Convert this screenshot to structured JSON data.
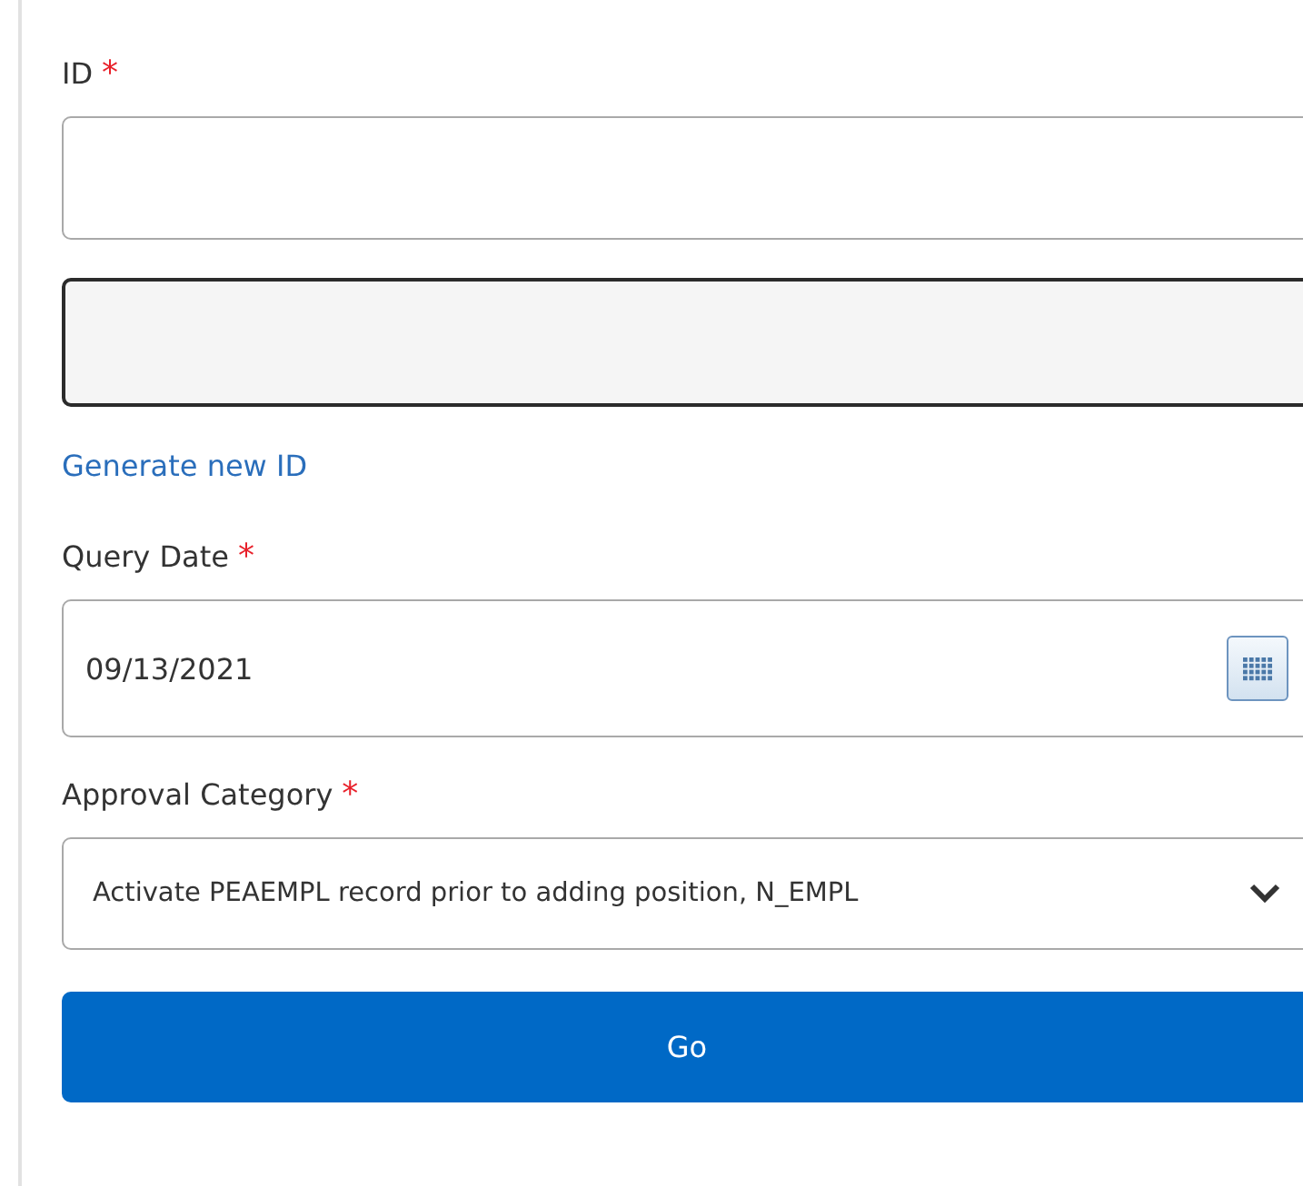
{
  "fields": [
    {
      "kind": "text",
      "label": "ID",
      "required": true,
      "required_mark": "*",
      "disabled": false
    },
    {
      "kind": "text",
      "disabled": true
    },
    {
      "kind": "link",
      "label": "Generate new ID"
    },
    {
      "kind": "date",
      "label": "Query Date",
      "required": true,
      "required_mark": "*",
      "value": "09/13/2021"
    },
    {
      "kind": "select",
      "label": "Approval Category",
      "required": true,
      "required_mark": "*",
      "value": "Activate PEAEMPL record prior to adding position, N_EMPL"
    }
  ],
  "button": "Go"
}
